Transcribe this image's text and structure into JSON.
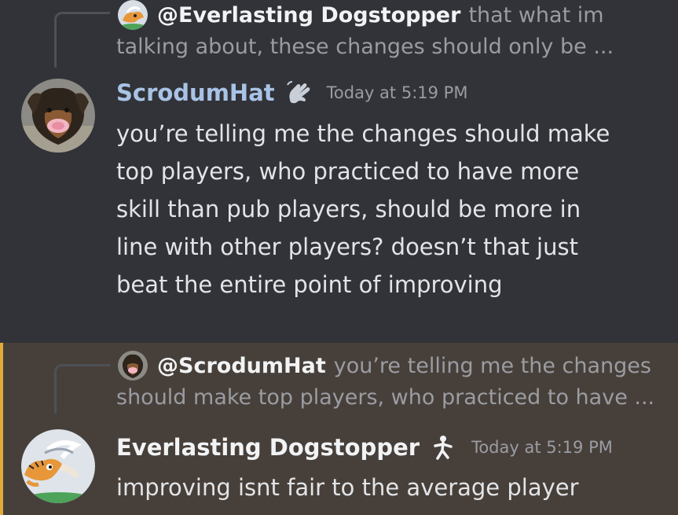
{
  "messages": [
    {
      "reply": {
        "author": "@Everlasting Dogstopper",
        "preview_line1": "that what im",
        "preview_line2": "talking about, these changes should only be ..."
      },
      "author": "ScrodumHat",
      "author_color": "#a9c3e6",
      "badge_icon": "hand-wave-icon",
      "timestamp": "Today at 5:19 PM",
      "lines": [
        "you’re telling me the changes should make",
        "top players, who practiced to have more",
        "skill than pub players, should be more in",
        "line with other players? doesn’t that just",
        "beat the entire point of improving"
      ]
    },
    {
      "reply": {
        "author": "@ScrodumHat",
        "preview_line1": "you’re telling me the changes",
        "preview_line2": "should make top players, who practiced to have ..."
      },
      "author": "Everlasting Dogstopper",
      "author_color": "#f2f3f5",
      "badge_icon": "running-figure-icon",
      "timestamp": "Today at 5:19 PM",
      "highlight_color": "#e0ad3b",
      "lines": [
        "improving isnt fair to the average player"
      ]
    }
  ]
}
